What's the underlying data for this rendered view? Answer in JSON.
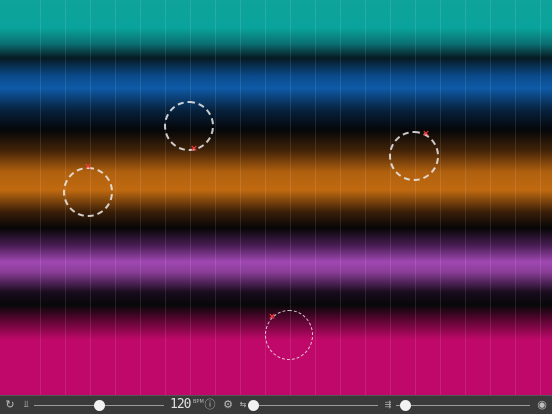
{
  "canvas": {
    "bands": [
      "teal",
      "blue",
      "orange",
      "purple",
      "magenta"
    ],
    "circles": [
      {
        "name": "circle-1"
      },
      {
        "name": "circle-2"
      },
      {
        "name": "circle-3"
      },
      {
        "name": "circle-4"
      }
    ]
  },
  "toolbar": {
    "bpm_value": "120",
    "bpm_unit": "BPM",
    "slider1_level": 0.5,
    "slider2_level": 0.02,
    "slider3_level": 0.07,
    "icons": [
      "refresh-icon",
      "tempo-down-icon",
      "info-icon",
      "settings-icon",
      "spread-icon",
      "density-icon",
      "record-icon"
    ]
  }
}
